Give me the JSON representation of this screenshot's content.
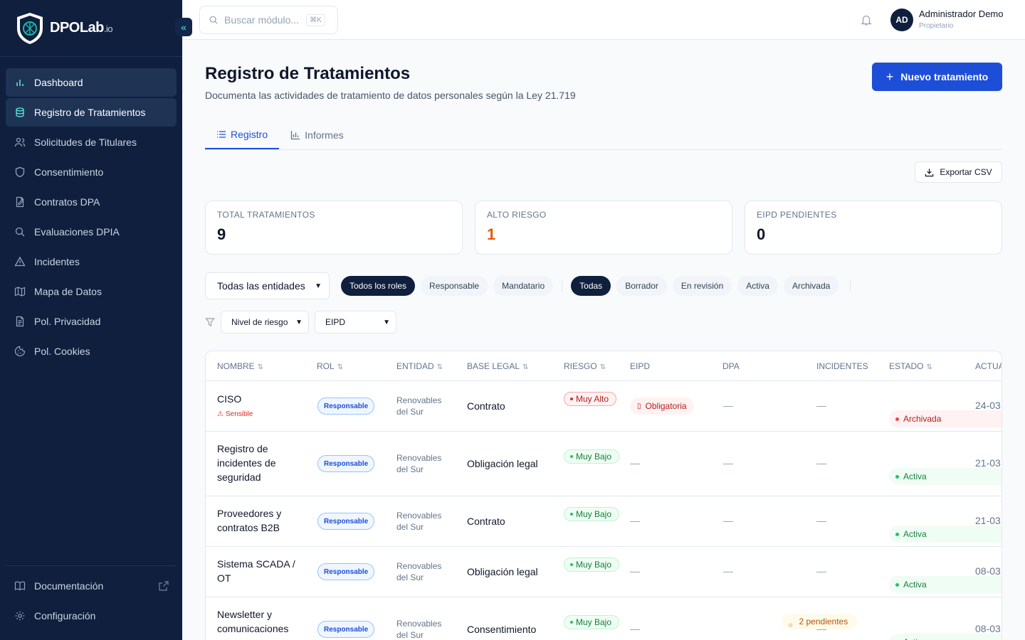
{
  "brand": {
    "name": "DPOLab",
    "suffix": ".io"
  },
  "sidebar": {
    "items": [
      {
        "label": "Dashboard",
        "icon": "bar-chart-icon"
      },
      {
        "label": "Registro de Tratamientos",
        "icon": "database-icon"
      },
      {
        "label": "Solicitudes de Titulares",
        "icon": "users-icon"
      },
      {
        "label": "Consentimiento",
        "icon": "shield-icon"
      },
      {
        "label": "Contratos DPA",
        "icon": "contract-icon"
      },
      {
        "label": "Evaluaciones DPIA",
        "icon": "search-icon"
      },
      {
        "label": "Incidentes",
        "icon": "warning-icon"
      },
      {
        "label": "Mapa de Datos",
        "icon": "map-icon"
      },
      {
        "label": "Pol. Privacidad",
        "icon": "document-icon"
      },
      {
        "label": "Pol. Cookies",
        "icon": "cookie-icon"
      }
    ],
    "bottom": [
      {
        "label": "Documentación",
        "icon": "book-icon"
      },
      {
        "label": "Configuración",
        "icon": "gear-icon"
      }
    ]
  },
  "topbar": {
    "search_placeholder": "Buscar módulo...",
    "shortcut": "⌘K",
    "user": {
      "initials": "AD",
      "name": "Administrador Demo",
      "role": "Propietario"
    }
  },
  "page": {
    "title": "Registro de Tratamientos",
    "subtitle": "Documenta las actividades de tratamiento de datos personales según la Ley 21.719",
    "new_button": "Nuevo tratamiento",
    "tabs": [
      "Registro",
      "Informes"
    ],
    "export_button": "Exportar CSV"
  },
  "stats": [
    {
      "label": "TOTAL TRATAMIENTOS",
      "value": "9"
    },
    {
      "label": "ALTO RIESGO",
      "value": "1"
    },
    {
      "label": "EIPD PENDIENTES",
      "value": "0"
    }
  ],
  "filters": {
    "entity_select": "Todas las entidades",
    "roles": [
      "Todos los roles",
      "Responsable",
      "Mandatario"
    ],
    "states": [
      "Todas",
      "Borrador",
      "En revisión",
      "Activa",
      "Archivada"
    ],
    "risk_select": "Nivel de riesgo",
    "eipd_select": "EIPD"
  },
  "table": {
    "columns": [
      "NOMBRE",
      "ROL",
      "ENTIDAD",
      "BASE LEGAL",
      "RIESGO",
      "EIPD",
      "DPA",
      "INCIDENTES",
      "ESTADO",
      "ACTUA"
    ],
    "dash": "—",
    "rows": [
      {
        "name": "CISO",
        "sensitive": "Sensible",
        "rol": "Responsable",
        "entity": "Renovables del Sur",
        "legal": "Contrato",
        "risk": "Muy Alto",
        "eipd": "Obligatoria",
        "dpa": "",
        "status": "Archivada",
        "date": "24-03"
      },
      {
        "name": "Registro de incidentes de seguridad",
        "sensitive": "",
        "rol": "Responsable",
        "entity": "Renovables del Sur",
        "legal": "Obligación legal",
        "risk": "Muy Bajo",
        "eipd": "",
        "dpa": "",
        "status": "Activa",
        "date": "21-03"
      },
      {
        "name": "Proveedores y contratos B2B",
        "sensitive": "",
        "rol": "Responsable",
        "entity": "Renovables del Sur",
        "legal": "Contrato",
        "risk": "Muy Bajo",
        "eipd": "",
        "dpa": "",
        "status": "Activa",
        "date": "21-03"
      },
      {
        "name": "Sistema SCADA / OT",
        "sensitive": "",
        "rol": "Responsable",
        "entity": "Renovables del Sur",
        "legal": "Obligación legal",
        "risk": "Muy Bajo",
        "eipd": "",
        "dpa": "",
        "status": "Activa",
        "date": "08-03"
      },
      {
        "name": "Newsletter y comunicaciones",
        "sensitive": "",
        "rol": "Responsable",
        "entity": "Renovables del Sur",
        "legal": "Consentimiento",
        "risk": "Muy Bajo",
        "eipd": "",
        "dpa": "2 pendientes",
        "status": "Activa",
        "date": "08-03"
      }
    ]
  },
  "colors": {
    "sidebar_bg": "#0f1f3d",
    "accent": "#1d4ed8",
    "danger": "#dc2626",
    "success": "#15803d",
    "warning": "#ea580c"
  }
}
